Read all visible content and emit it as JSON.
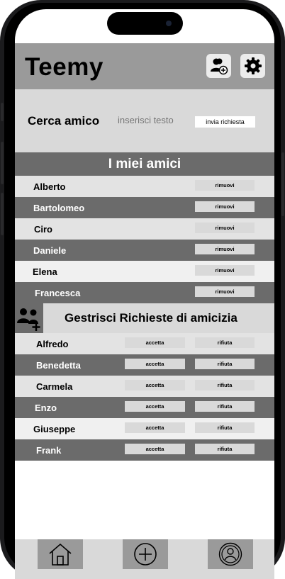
{
  "header": {
    "app_title": "Teemy"
  },
  "search": {
    "title": "Cerca amico",
    "placeholder": "inserisci testo",
    "send_label": "invia richiesta"
  },
  "friends": {
    "title": "I miei amici",
    "remove_label": "rimuovi",
    "items": [
      {
        "name": "Alberto"
      },
      {
        "name": "Bartolomeo"
      },
      {
        "name": "Ciro"
      },
      {
        "name": "Daniele"
      },
      {
        "name": "Elena"
      },
      {
        "name": "Francesca"
      }
    ]
  },
  "requests": {
    "title": "Gestrisci Richieste di amicizia",
    "accept_label": "accetta",
    "reject_label": "rifiuta",
    "items": [
      {
        "name": "Alfredo"
      },
      {
        "name": "Benedetta"
      },
      {
        "name": "Carmela"
      },
      {
        "name": "Enzo"
      },
      {
        "name": "Giuseppe"
      },
      {
        "name": "Frank"
      }
    ]
  },
  "tabbar": {
    "items": [
      "home-icon",
      "add-circle-icon",
      "profile-icon"
    ]
  }
}
